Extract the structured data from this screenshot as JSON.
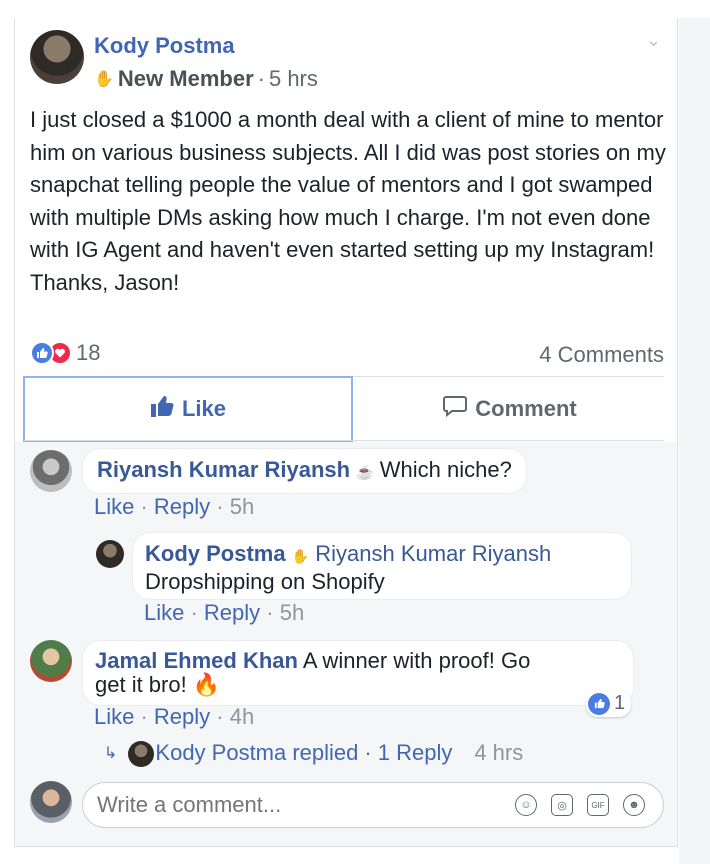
{
  "post": {
    "author": "Kody Postma",
    "badge": "New Member",
    "separator": "·",
    "time": "5 hrs",
    "text": "I just closed a $1000 a month deal with a client of mine to mentor him on various business subjects. All I did was post stories on my snapchat telling people the value of mentors and I got swamped with multiple DMs asking how much I charge. I'm not even done with IG Agent and haven't even started setting up my Instagram! Thanks, Jason!",
    "reaction_count": "18",
    "comments_count": "4 Comments"
  },
  "actions": {
    "like": "Like",
    "comment": "Comment"
  },
  "comments": [
    {
      "name": "Riyansh Kumar Riyansh",
      "text": "Which niche?",
      "like": "Like",
      "reply": "Reply",
      "time": "5h"
    },
    {
      "name": "Kody Postma",
      "mention": "Riyansh Kumar Riyansh",
      "text": "Dropshipping on Shopify",
      "like": "Like",
      "reply": "Reply",
      "time": "5h"
    },
    {
      "name": "Jamal Ehmed Khan",
      "text_line1": "A winner with proof! Go",
      "text_line2": "get it bro!",
      "reaction_count": "1",
      "like": "Like",
      "reply": "Reply",
      "time": "4h"
    }
  ],
  "reply_thread": {
    "label": "Kody Postma replied",
    "sep": "·",
    "count": "1 Reply",
    "time": "4 hrs"
  },
  "composer": {
    "placeholder": "Write a comment..."
  },
  "icons": {
    "chevron": "chevron-down-icon",
    "like": "thumbs-up-icon",
    "love": "heart-icon",
    "comment": "speech-bubble-icon",
    "emoji": "smiley-icon",
    "camera": "camera-icon",
    "gif": "gif-icon",
    "sticker": "sticker-icon"
  },
  "colors": {
    "link": "#4267b2",
    "like_reaction": "#4a7de2",
    "love_reaction": "#f0284a",
    "meta": "#616770"
  }
}
